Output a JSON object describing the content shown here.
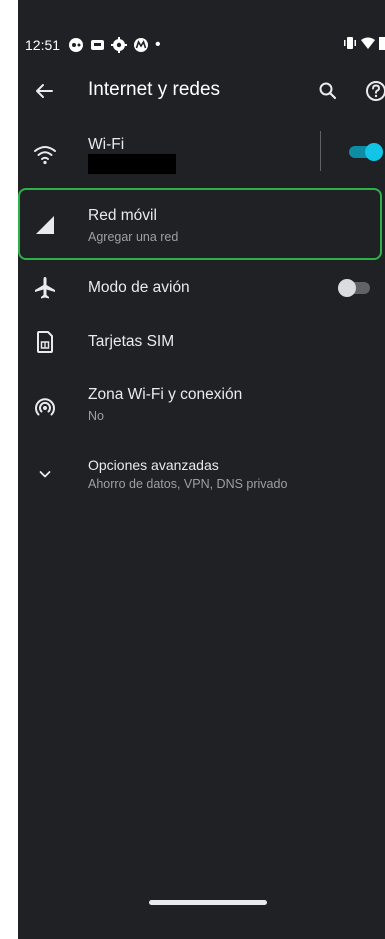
{
  "status_bar": {
    "time": "12:51",
    "dot": "•"
  },
  "app_bar": {
    "title": "Internet y redes",
    "back_icon": "arrow-back-icon",
    "search_icon": "search-icon",
    "help_icon": "help-circle-icon"
  },
  "settings": {
    "wifi": {
      "title": "Wi-Fi",
      "enabled": true,
      "icon": "wifi-icon"
    },
    "mobile_network": {
      "title": "Red móvil",
      "subtitle": "Agregar una red",
      "icon": "cell-signal-icon",
      "highlighted": true
    },
    "airplane_mode": {
      "title": "Modo de avión",
      "enabled": false,
      "icon": "airplane-icon"
    },
    "sim_cards": {
      "title": "Tarjetas SIM",
      "icon": "sim-card-icon"
    },
    "hotspot": {
      "title": "Zona Wi-Fi y conexión",
      "subtitle": "No",
      "icon": "hotspot-icon"
    },
    "advanced": {
      "title": "Opciones avanzadas",
      "subtitle": "Ahorro de datos, VPN, DNS privado",
      "icon": "chevron-down-icon"
    }
  },
  "colors": {
    "background": "#202124",
    "accent": "#12c4e6",
    "highlight_border": "#2db24a",
    "primary_text": "#e8eaed",
    "secondary_text": "#9aa0a6"
  }
}
